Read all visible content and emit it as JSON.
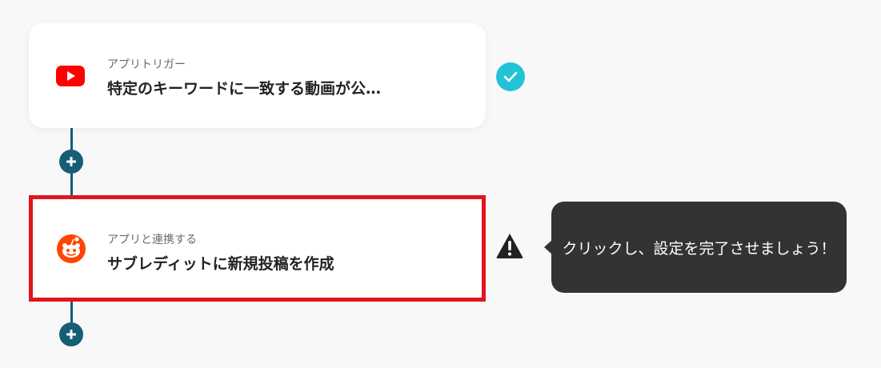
{
  "flow": {
    "trigger_step": {
      "subtitle": "アプリトリガー",
      "title": "特定のキーワードに一致する動画が公…",
      "icon": "youtube-icon",
      "status_icon": "check-circle-icon",
      "accent": "#ff0000"
    },
    "action_step": {
      "subtitle": "アプリと連携する",
      "title": "サブレディットに新規投稿を作成",
      "icon": "reddit-icon",
      "status_icon": "warning-icon",
      "accent": "#ff4500",
      "highlight_color": "#e0161e"
    },
    "tooltip": {
      "text": "クリックし、設定を完了させましょう！"
    },
    "connector_color": "#155e75",
    "check_color": "#22c3d6"
  }
}
